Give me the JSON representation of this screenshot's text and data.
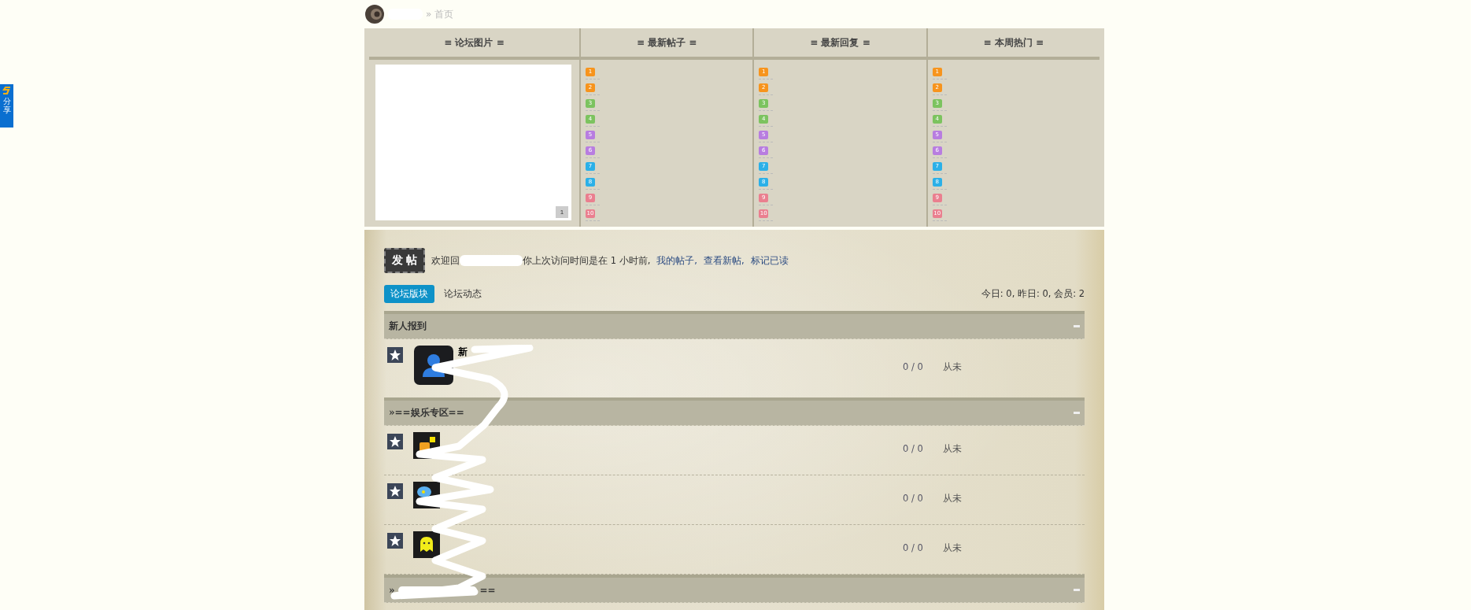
{
  "share_button": {
    "label": "分享"
  },
  "breadcrumb": {
    "separator": "»",
    "current": "首页"
  },
  "rank_panel": {
    "image_title": "≡ 论坛图片 ≡",
    "image_pager": "1",
    "lists": [
      {
        "title": "≡ 最新帖子 ≡",
        "items": [
          {
            "rank": "1",
            "color": "#f7941d"
          },
          {
            "rank": "2",
            "color": "#f7941d"
          },
          {
            "rank": "3",
            "color": "#7cc35f"
          },
          {
            "rank": "4",
            "color": "#7cc35f"
          },
          {
            "rank": "5",
            "color": "#b87de0"
          },
          {
            "rank": "6",
            "color": "#b87de0"
          },
          {
            "rank": "7",
            "color": "#2bb0e8"
          },
          {
            "rank": "8",
            "color": "#2bb0e8"
          },
          {
            "rank": "9",
            "color": "#ea7f8f"
          },
          {
            "rank": "10",
            "color": "#ea7f8f"
          }
        ]
      },
      {
        "title": "≡ 最新回复 ≡",
        "items": [
          {
            "rank": "1",
            "color": "#f7941d"
          },
          {
            "rank": "2",
            "color": "#f7941d"
          },
          {
            "rank": "3",
            "color": "#7cc35f"
          },
          {
            "rank": "4",
            "color": "#7cc35f"
          },
          {
            "rank": "5",
            "color": "#b87de0"
          },
          {
            "rank": "6",
            "color": "#b87de0"
          },
          {
            "rank": "7",
            "color": "#2bb0e8"
          },
          {
            "rank": "8",
            "color": "#2bb0e8"
          },
          {
            "rank": "9",
            "color": "#ea7f8f"
          },
          {
            "rank": "10",
            "color": "#ea7f8f"
          }
        ]
      },
      {
        "title": "≡ 本周热门 ≡",
        "items": [
          {
            "rank": "1",
            "color": "#f7941d"
          },
          {
            "rank": "2",
            "color": "#f7941d"
          },
          {
            "rank": "3",
            "color": "#7cc35f"
          },
          {
            "rank": "4",
            "color": "#7cc35f"
          },
          {
            "rank": "5",
            "color": "#b87de0"
          },
          {
            "rank": "6",
            "color": "#b87de0"
          },
          {
            "rank": "7",
            "color": "#2bb0e8"
          },
          {
            "rank": "8",
            "color": "#2bb0e8"
          },
          {
            "rank": "9",
            "color": "#ea7f8f"
          },
          {
            "rank": "10",
            "color": "#ea7f8f"
          }
        ]
      }
    ]
  },
  "post_button": {
    "label": "发 帖"
  },
  "welcome": {
    "before": "欢迎回",
    "after": "你上次访问时间是在 1 小时前,",
    "links": [
      "我的帖子,",
      "查看新帖,",
      "标记已读"
    ]
  },
  "tabs": [
    {
      "label": "论坛版块",
      "selected": true
    },
    {
      "label": "论坛动态",
      "selected": false
    }
  ],
  "stats": "今日: 0, 昨日: 0, 会员: 2",
  "sections": [
    {
      "title": "新人报到",
      "forums": [
        {
          "kind": "person",
          "name": "新",
          "counts": "0 / 0",
          "last_post": "从未"
        }
      ]
    },
    {
      "title": "»==娱乐专区==",
      "forums": [
        {
          "kind": "blocks",
          "counts": "0 / 0",
          "last_post": "从未"
        },
        {
          "kind": "bubbles",
          "counts": "0 / 0",
          "last_post": "从未"
        },
        {
          "kind": "ghost",
          "counts": "0 / 0",
          "last_post": "从未"
        }
      ]
    },
    {
      "title_start": "»",
      "title_end": "=="
    }
  ]
}
